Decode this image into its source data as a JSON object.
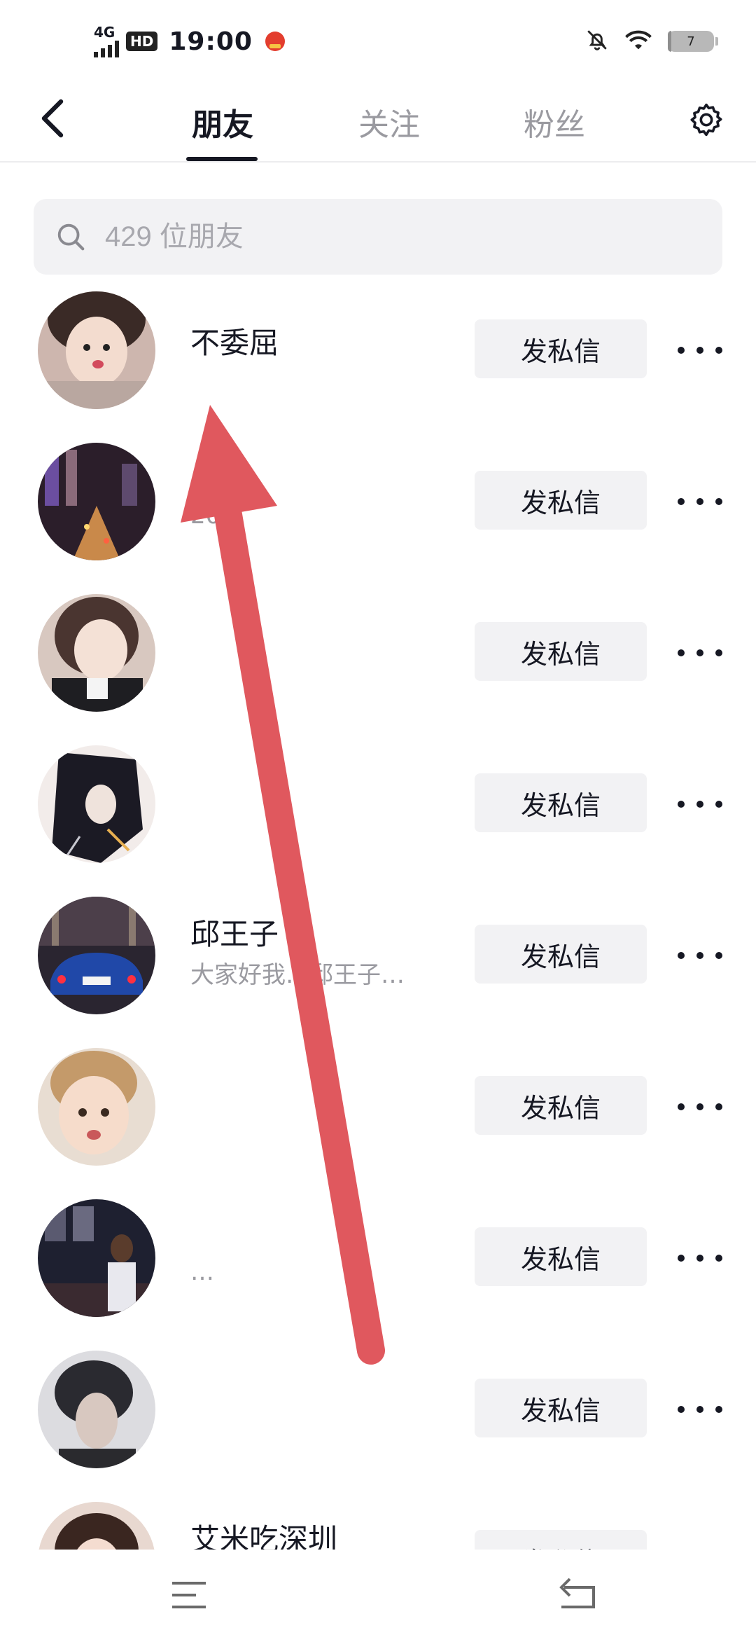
{
  "status_bar": {
    "network": "4G",
    "hd": "HD",
    "time": "19:00",
    "battery": "7"
  },
  "header": {
    "tabs": [
      {
        "label": "朋友",
        "active": true
      },
      {
        "label": "关注",
        "active": false
      },
      {
        "label": "粉丝",
        "active": false
      }
    ]
  },
  "search": {
    "placeholder": "429 位朋友"
  },
  "friends": [
    {
      "name": "不委屈",
      "subtitle": "",
      "button": "发私信"
    },
    {
      "name": "…",
      "subtitle": "20…",
      "button": "发私信"
    },
    {
      "name": "",
      "subtitle": "",
      "button": "发私信"
    },
    {
      "name": "",
      "subtitle": "",
      "button": "发私信"
    },
    {
      "name": "邱王子",
      "subtitle": "大家好我…邱王子…",
      "button": "发私信"
    },
    {
      "name": "",
      "subtitle": "",
      "button": "发私信"
    },
    {
      "name": "",
      "subtitle": "…",
      "button": "发私信"
    },
    {
      "name": "",
      "subtitle": "",
      "button": "发私信"
    },
    {
      "name": "艾米吃深圳",
      "subtitle": "",
      "button": "发私信"
    }
  ],
  "colors": {
    "accent": "#161823",
    "muted": "#9a9aa0",
    "button_bg": "#f2f2f4",
    "arrow": "#e0585e"
  },
  "icons": {
    "back": "chevron-left-icon",
    "settings": "gear-icon",
    "search": "search-icon",
    "more": "more-horizontal-icon"
  }
}
